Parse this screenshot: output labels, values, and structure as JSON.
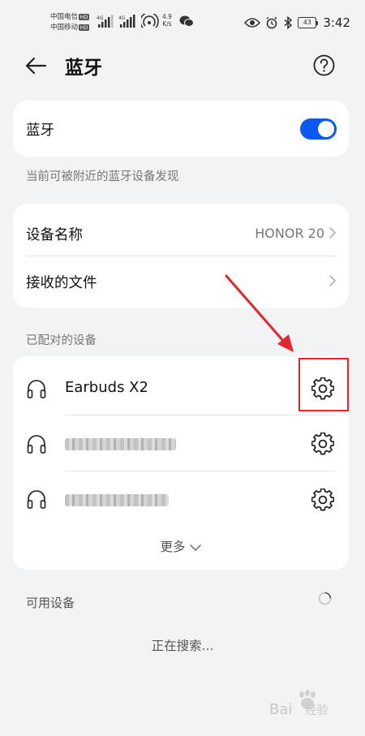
{
  "status": {
    "carrier1": "中国电信",
    "carrier2": "中国移动",
    "hd_badge": "HD",
    "net1": "4G",
    "net2": "4G",
    "speed_value": "4.9",
    "speed_unit": "K/s",
    "battery": "43",
    "time": "3:42"
  },
  "header": {
    "title": "蓝牙"
  },
  "bluetooth": {
    "label": "蓝牙",
    "enabled": true
  },
  "visibility_hint": "当前可被附近的蓝牙设备发现",
  "settings": {
    "device_name_label": "设备名称",
    "device_name_value": "HONOR 20",
    "received_files_label": "接收的文件"
  },
  "paired": {
    "section_label": "已配对的设备",
    "devices": [
      {
        "name": "Earbuds X2"
      },
      {
        "name": ""
      },
      {
        "name": ""
      }
    ],
    "more_label": "更多"
  },
  "available": {
    "section_label": "可用设备",
    "searching_text": "正在搜索..."
  },
  "watermark": {
    "text": "Bai",
    "text2": "经验"
  },
  "colors": {
    "accent": "#0a59f7",
    "highlight": "#e8252a"
  }
}
